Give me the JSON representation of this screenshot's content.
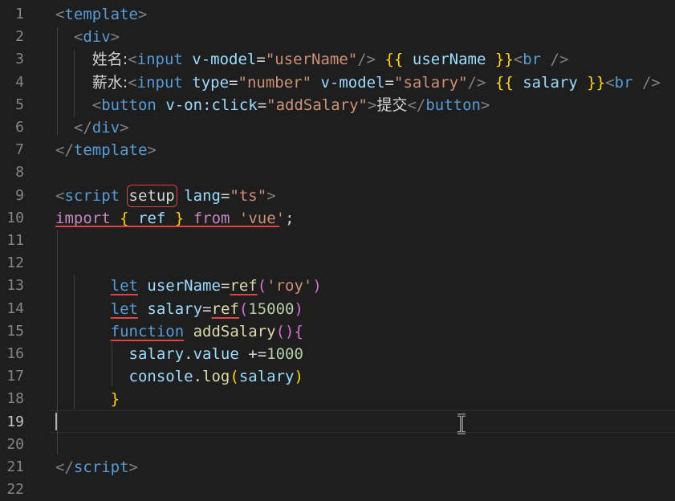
{
  "editor": {
    "active_line": 19,
    "lines": [
      {
        "n": "1",
        "tokens": [
          [
            "punc",
            "<"
          ],
          [
            "tag",
            "template"
          ],
          [
            "punc",
            ">"
          ]
        ]
      },
      {
        "n": "2",
        "tokens": [
          [
            "txt",
            "  "
          ],
          [
            "punc",
            "<"
          ],
          [
            "tag",
            "div"
          ],
          [
            "punc",
            ">"
          ]
        ]
      },
      {
        "n": "3",
        "tokens": [
          [
            "txt",
            "    "
          ],
          [
            "cjk",
            "姓名:"
          ],
          [
            "punc",
            "<"
          ],
          [
            "tag",
            "input"
          ],
          [
            "txt",
            " "
          ],
          [
            "attr",
            "v-model"
          ],
          [
            "txt",
            "="
          ],
          [
            "str",
            "\"userName\""
          ],
          [
            "punc",
            "/>"
          ],
          [
            "txt",
            " "
          ],
          [
            "brace",
            "{{"
          ],
          [
            "txt",
            " "
          ],
          [
            "var",
            "userName"
          ],
          [
            "txt",
            " "
          ],
          [
            "brace",
            "}}"
          ],
          [
            "punc",
            "<"
          ],
          [
            "tag",
            "br"
          ],
          [
            "txt",
            " "
          ],
          [
            "punc",
            "/>"
          ]
        ]
      },
      {
        "n": "4",
        "tokens": [
          [
            "txt",
            "    "
          ],
          [
            "cjk",
            "薪水:"
          ],
          [
            "punc",
            "<"
          ],
          [
            "tag",
            "input"
          ],
          [
            "txt",
            " "
          ],
          [
            "attr",
            "type"
          ],
          [
            "txt",
            "="
          ],
          [
            "str",
            "\"number\""
          ],
          [
            "txt",
            " "
          ],
          [
            "attr",
            "v-model"
          ],
          [
            "txt",
            "="
          ],
          [
            "str",
            "\"salary\""
          ],
          [
            "punc",
            "/>"
          ],
          [
            "txt",
            " "
          ],
          [
            "brace",
            "{{"
          ],
          [
            "txt",
            " "
          ],
          [
            "var",
            "salary"
          ],
          [
            "txt",
            " "
          ],
          [
            "brace",
            "}}"
          ],
          [
            "punc",
            "<"
          ],
          [
            "tag",
            "br"
          ],
          [
            "txt",
            " "
          ],
          [
            "punc",
            "/>"
          ]
        ]
      },
      {
        "n": "5",
        "tokens": [
          [
            "txt",
            "    "
          ],
          [
            "punc",
            "<"
          ],
          [
            "tag",
            "button"
          ],
          [
            "txt",
            " "
          ],
          [
            "attr",
            "v-on:click"
          ],
          [
            "txt",
            "="
          ],
          [
            "str",
            "\"addSalary\""
          ],
          [
            "punc",
            ">"
          ],
          [
            "cjk",
            "提交"
          ],
          [
            "punc",
            "</"
          ],
          [
            "tag",
            "button"
          ],
          [
            "punc",
            ">"
          ]
        ]
      },
      {
        "n": "6",
        "tokens": [
          [
            "txt",
            "  "
          ],
          [
            "punc",
            "</"
          ],
          [
            "tag",
            "div"
          ],
          [
            "punc",
            ">"
          ]
        ]
      },
      {
        "n": "7",
        "tokens": [
          [
            "punc",
            "</"
          ],
          [
            "tag",
            "template"
          ],
          [
            "punc",
            ">"
          ]
        ]
      },
      {
        "n": "8",
        "tokens": []
      },
      {
        "n": "9",
        "tokens": [
          [
            "punc",
            "<"
          ],
          [
            "tag",
            "script"
          ],
          [
            "txt",
            " "
          ],
          [
            "boxed",
            "setup"
          ],
          [
            "txt",
            " "
          ],
          [
            "attr",
            "lang"
          ],
          [
            "txt",
            "="
          ],
          [
            "str",
            "\"ts\""
          ],
          [
            "punc",
            ">"
          ]
        ]
      },
      {
        "n": "10",
        "tokens": [
          [
            "kw",
            "import"
          ],
          [
            "txt",
            " "
          ],
          [
            "brace",
            "{"
          ],
          [
            "txt",
            " "
          ],
          [
            "var",
            "ref"
          ],
          [
            "txt",
            " "
          ],
          [
            "brace",
            "}"
          ],
          [
            "txt",
            " "
          ],
          [
            "kw",
            "from"
          ],
          [
            "txt",
            " "
          ],
          [
            "str",
            "'vue'"
          ],
          [
            "txt",
            ";"
          ]
        ]
      },
      {
        "n": "11",
        "tokens": []
      },
      {
        "n": "12",
        "tokens": []
      },
      {
        "n": "13",
        "tokens": [
          [
            "txt",
            "      "
          ],
          [
            "keyu",
            "let"
          ],
          [
            "txt",
            " "
          ],
          [
            "var",
            "userName"
          ],
          [
            "txt",
            "="
          ],
          [
            "fnu",
            "ref"
          ],
          [
            "brace2",
            "("
          ],
          [
            "str",
            "'roy'"
          ],
          [
            "brace2",
            ")"
          ]
        ]
      },
      {
        "n": "14",
        "tokens": [
          [
            "txt",
            "      "
          ],
          [
            "keyu",
            "let"
          ],
          [
            "txt",
            " "
          ],
          [
            "var",
            "salary"
          ],
          [
            "txt",
            "="
          ],
          [
            "fnu",
            "ref"
          ],
          [
            "brace2",
            "("
          ],
          [
            "num",
            "15000"
          ],
          [
            "brace2",
            ")"
          ]
        ]
      },
      {
        "n": "15",
        "tokens": [
          [
            "txt",
            "      "
          ],
          [
            "keyu",
            "function"
          ],
          [
            "txt",
            " "
          ],
          [
            "fn",
            "addSalary"
          ],
          [
            "brace2",
            "()"
          ],
          [
            "brace2",
            "{"
          ]
        ]
      },
      {
        "n": "16",
        "tokens": [
          [
            "txt",
            "        "
          ],
          [
            "var",
            "salary"
          ],
          [
            "txt",
            "."
          ],
          [
            "var",
            "value"
          ],
          [
            "txt",
            " +="
          ],
          [
            "num",
            "1000"
          ]
        ]
      },
      {
        "n": "17",
        "tokens": [
          [
            "txt",
            "        "
          ],
          [
            "var",
            "console"
          ],
          [
            "txt",
            "."
          ],
          [
            "fn",
            "log"
          ],
          [
            "brace",
            "("
          ],
          [
            "var",
            "salary"
          ],
          [
            "brace",
            ")"
          ]
        ]
      },
      {
        "n": "18",
        "tokens": [
          [
            "txt",
            "      "
          ],
          [
            "brace",
            "}"
          ]
        ]
      },
      {
        "n": "19",
        "tokens": []
      },
      {
        "n": "20",
        "tokens": []
      },
      {
        "n": "21",
        "tokens": [
          [
            "punc",
            "</"
          ],
          [
            "tag",
            "script"
          ],
          [
            "punc",
            ">"
          ]
        ]
      },
      {
        "n": "22",
        "tokens": []
      }
    ]
  }
}
